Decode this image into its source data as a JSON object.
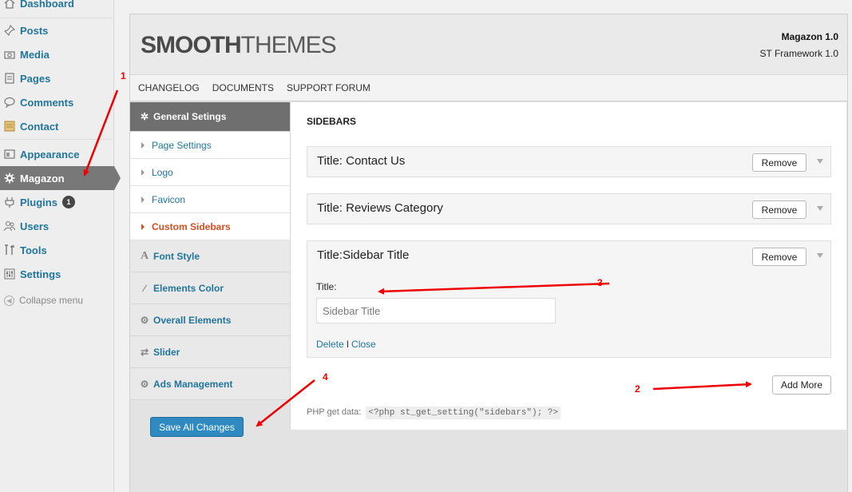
{
  "wp_menu": {
    "items": [
      {
        "label": "Dashboard",
        "icon": "home-icon"
      },
      {
        "label": "Posts",
        "icon": "pin-icon"
      },
      {
        "label": "Media",
        "icon": "camera-icon"
      },
      {
        "label": "Pages",
        "icon": "pages-icon"
      },
      {
        "label": "Comments",
        "icon": "comment-icon"
      },
      {
        "label": "Contact",
        "icon": "contact-icon"
      },
      {
        "label": "Appearance",
        "icon": "appearance-icon"
      },
      {
        "label": "Magazon",
        "icon": "gear-icon"
      },
      {
        "label": "Plugins",
        "icon": "plug-icon"
      },
      {
        "label": "Users",
        "icon": "users-icon"
      },
      {
        "label": "Tools",
        "icon": "tools-icon"
      },
      {
        "label": "Settings",
        "icon": "sliders-icon"
      }
    ],
    "plugins_badge": "1",
    "collapse_label": "Collapse menu"
  },
  "header": {
    "logo_bold": "SMOOTH",
    "logo_light": "THEMES",
    "theme_version": "Magazon 1.0",
    "framework_version": "ST Framework 1.0"
  },
  "topnav": [
    "CHANGELOG",
    "DOCUMENTS",
    "SUPPORT FORUM"
  ],
  "settings_nav": {
    "head": "General Setings",
    "sub": [
      "Page Settings",
      "Logo",
      "Favicon",
      "Custom Sidebars"
    ],
    "sections": [
      "Font Style",
      "Elements Color",
      "Overall Elements",
      "Slider",
      "Ads Management"
    ],
    "save_label": "Save All Changes"
  },
  "content": {
    "section_title": "SIDEBARS",
    "sidebars": [
      {
        "title": "Title: Contact Us"
      },
      {
        "title": "Title: Reviews Category"
      },
      {
        "title": "Title:Sidebar Title"
      }
    ],
    "remove_label": "Remove",
    "field_label": "Title:",
    "field_value": "Sidebar Title",
    "delete_label": "Delete",
    "link_sep": "I",
    "close_label": "Close",
    "add_more_label": "Add More",
    "php_label": "PHP get data:",
    "php_code": "<?php st_get_setting(\"sidebars\"); ?>"
  },
  "annotations": [
    "1",
    "2",
    "3",
    "4"
  ],
  "colors": {
    "annotation": "#ee0000",
    "link": "#21759b",
    "active_sub": "#d54e21",
    "primary_button": "#2e8ac0"
  }
}
